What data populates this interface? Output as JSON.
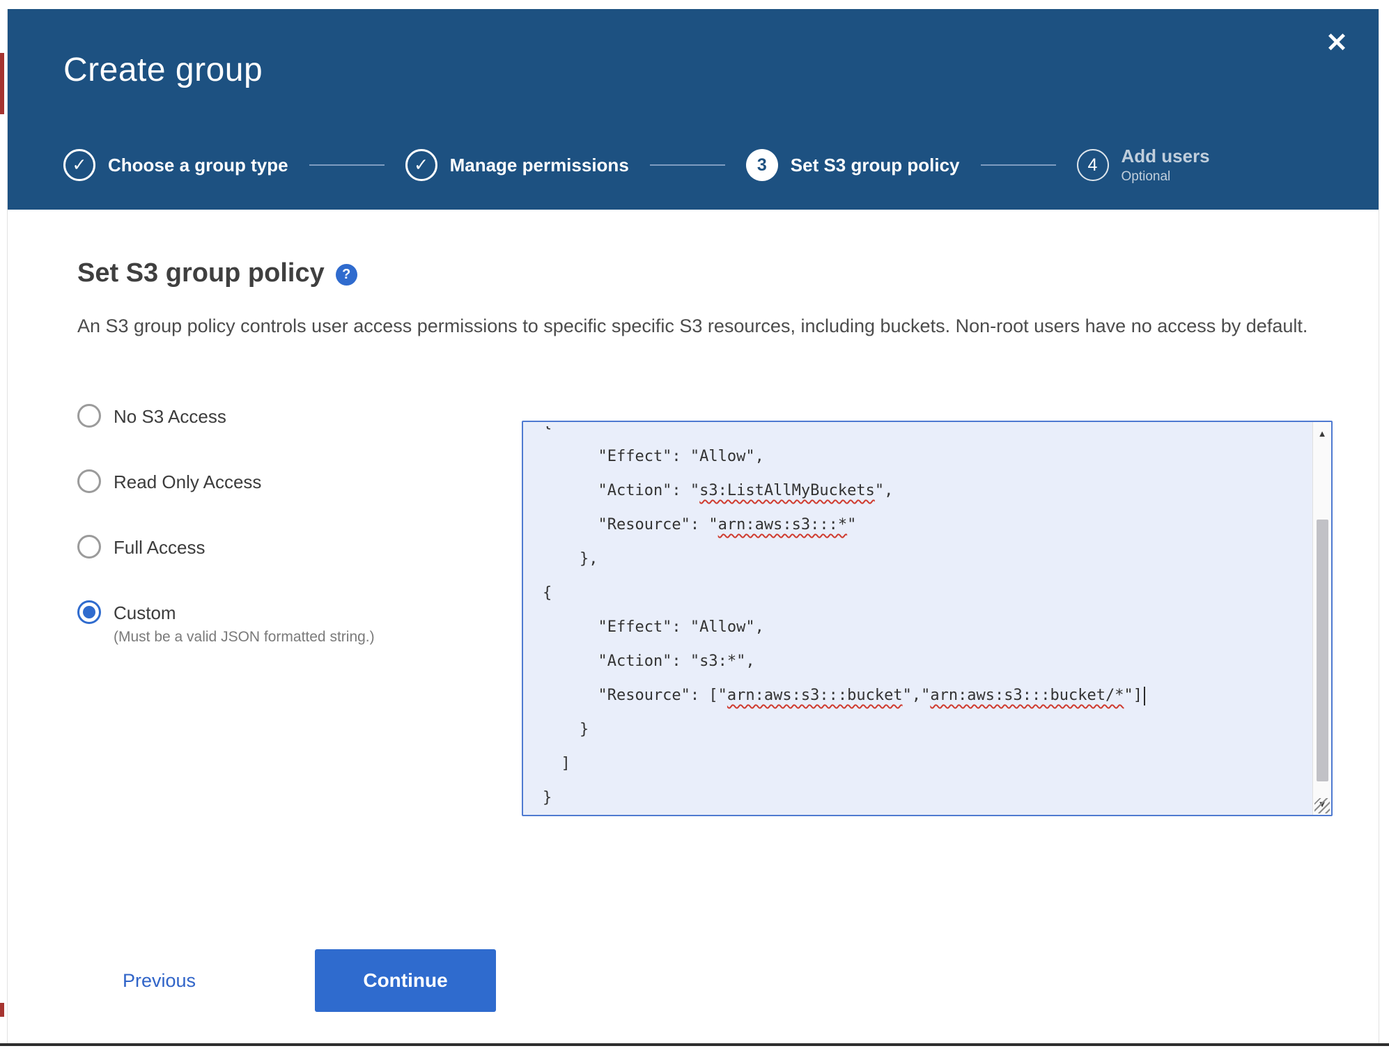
{
  "colors": {
    "header_bg": "#1d5181",
    "accent": "#2f6bce",
    "editor_bg": "#e9eefa",
    "editor_border": "#4f7ad1",
    "spellcheck_underline": "#cf3b2f"
  },
  "icons": {
    "close": "✕",
    "check": "✓",
    "help": "?",
    "scroll_up": "▲",
    "scroll_down": "▼"
  },
  "header": {
    "title": "Create group"
  },
  "stepper": {
    "steps": [
      {
        "label": "Choose a group type",
        "state": "complete"
      },
      {
        "label": "Manage permissions",
        "state": "complete"
      },
      {
        "label": "Set S3 group policy",
        "state": "current",
        "number": "3"
      },
      {
        "label": "Add users",
        "sublabel": "Optional",
        "state": "upcoming",
        "number": "4"
      }
    ]
  },
  "main": {
    "title": "Set S3 group policy",
    "description": "An S3 group policy controls user access permissions to specific specific S3 resources, including buckets. Non-root users have no access by default.",
    "options": [
      {
        "label": "No S3 Access",
        "selected": false
      },
      {
        "label": "Read Only Access",
        "selected": false
      },
      {
        "label": "Full Access",
        "selected": false
      },
      {
        "label": "Custom",
        "selected": true,
        "helper": "(Must be a valid JSON formatted string.)"
      }
    ],
    "editor": {
      "lines": [
        {
          "clipped": true,
          "segments": [
            {
              "t": "{"
            }
          ]
        },
        {
          "segments": [
            {
              "t": "      \"Effect\": \"Allow\","
            }
          ]
        },
        {
          "segments": [
            {
              "t": "      \"Action\": \""
            },
            {
              "t": "s3:ListAllMyBuckets",
              "misspelled": true
            },
            {
              "t": "\","
            }
          ]
        },
        {
          "segments": [
            {
              "t": "      \"Resource\": \""
            },
            {
              "t": "arn:aws:s3:::*",
              "misspelled": true
            },
            {
              "t": "\""
            }
          ]
        },
        {
          "segments": [
            {
              "t": "    },"
            }
          ]
        },
        {
          "segments": [
            {
              "t": "{"
            }
          ]
        },
        {
          "segments": [
            {
              "t": "      \"Effect\": \"Allow\","
            }
          ]
        },
        {
          "segments": [
            {
              "t": "      \"Action\": \"s3:*\","
            }
          ]
        },
        {
          "caret": true,
          "segments": [
            {
              "t": "      \"Resource\": [\""
            },
            {
              "t": "arn:aws:s3:::bucket",
              "misspelled": true
            },
            {
              "t": "\",\""
            },
            {
              "t": "arn:aws:s3:::bucket/*",
              "misspelled": true
            },
            {
              "t": "\"]"
            }
          ]
        },
        {
          "segments": [
            {
              "t": "    }"
            }
          ]
        },
        {
          "segments": [
            {
              "t": "  ]"
            }
          ]
        },
        {
          "segments": [
            {
              "t": "}"
            }
          ]
        }
      ]
    }
  },
  "footer": {
    "previous_label": "Previous",
    "continue_label": "Continue"
  }
}
